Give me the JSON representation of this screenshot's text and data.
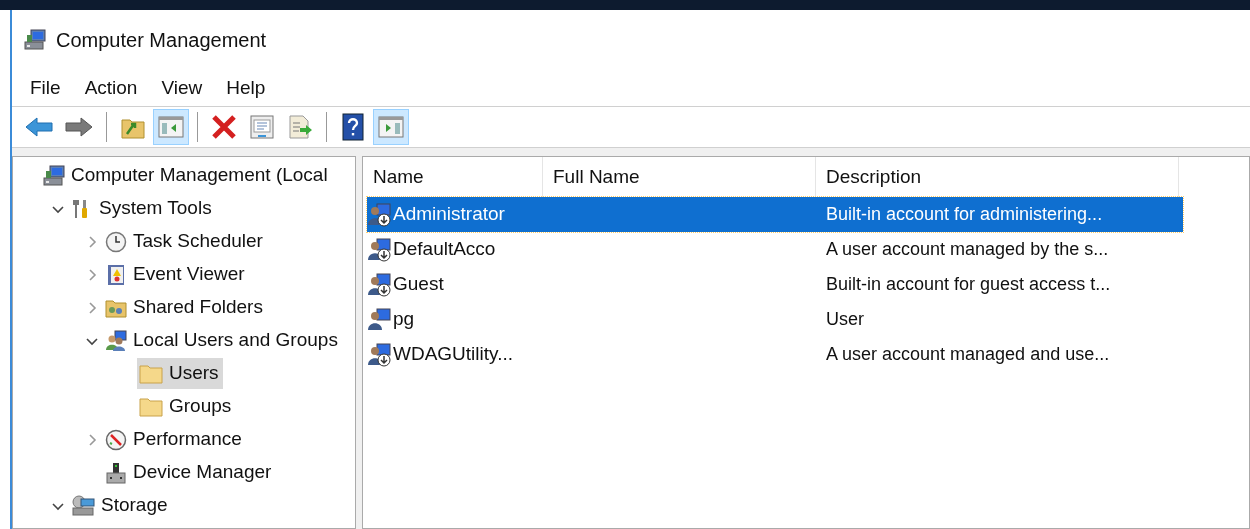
{
  "window": {
    "title": "Computer Management"
  },
  "menu": [
    "File",
    "Action",
    "View",
    "Help"
  ],
  "toolbar": [
    {
      "kind": "back",
      "pressed": false
    },
    {
      "kind": "forward",
      "pressed": false
    },
    {
      "kind": "separator"
    },
    {
      "kind": "up",
      "pressed": false
    },
    {
      "kind": "tree",
      "pressed": true
    },
    {
      "kind": "separator"
    },
    {
      "kind": "delete",
      "pressed": false
    },
    {
      "kind": "properties",
      "pressed": false
    },
    {
      "kind": "export",
      "pressed": false
    },
    {
      "kind": "separator"
    },
    {
      "kind": "help",
      "pressed": false
    },
    {
      "kind": "actions",
      "pressed": true
    }
  ],
  "tree": [
    {
      "label": "Computer Management (Local",
      "kind": "computer",
      "selected": false,
      "children": [
        {
          "label": "System Tools",
          "kind": "tools",
          "expanded": true,
          "selected": false,
          "children": [
            {
              "label": "Task Scheduler",
              "kind": "clock",
              "expanded": false,
              "selected": false
            },
            {
              "label": "Event Viewer",
              "kind": "events",
              "expanded": false,
              "selected": false
            },
            {
              "label": "Shared Folders",
              "kind": "shared",
              "expanded": false,
              "selected": false
            },
            {
              "label": "Local Users and Groups",
              "kind": "users",
              "expanded": true,
              "selected": false,
              "children": [
                {
                  "label": "Users",
                  "kind": "folder",
                  "selected": true
                },
                {
                  "label": "Groups",
                  "kind": "folder",
                  "selected": false
                }
              ]
            },
            {
              "label": "Performance",
              "kind": "gauge",
              "expanded": false,
              "selected": false
            },
            {
              "label": "Device Manager",
              "kind": "device",
              "selected": false
            }
          ]
        },
        {
          "label": "Storage",
          "kind": "storage",
          "expanded": true,
          "selected": false
        }
      ]
    }
  ],
  "table": {
    "columns": [
      "Name",
      "Full Name",
      "Description"
    ],
    "rows": [
      {
        "name": "Administrator",
        "description": "Built-in account for administering...",
        "selected": true,
        "disabled": true
      },
      {
        "name": "DefaultAcco",
        "description": "A user account managed by the s...",
        "selected": false,
        "disabled": true
      },
      {
        "name": "Guest",
        "description": "Built-in account for guest access t...",
        "selected": false,
        "disabled": true
      },
      {
        "name": "pg",
        "description": "User",
        "selected": false,
        "disabled": false
      },
      {
        "name": "WDAGUtility...",
        "description": "A user account managed and use...",
        "selected": false,
        "disabled": true
      }
    ]
  }
}
